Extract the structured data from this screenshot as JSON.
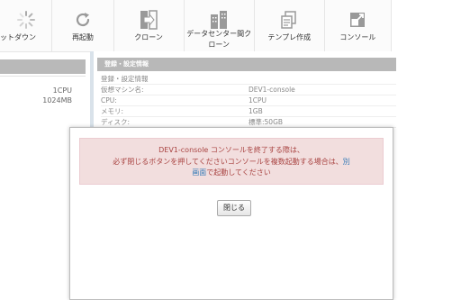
{
  "toolbar": {
    "items": [
      {
        "label": "ットダウン",
        "icon": "shutdown-spinner-icon"
      },
      {
        "label": "再起動",
        "icon": "restart-icon"
      },
      {
        "label": "クローン",
        "icon": "clone-icon"
      },
      {
        "label_line1": "データセンター間ク",
        "label_line2": "ローン",
        "icon": "datacenter-clone-icon"
      },
      {
        "label": "テンプレ作成",
        "icon": "template-icon"
      },
      {
        "label": "コンソール",
        "icon": "console-icon"
      }
    ]
  },
  "left_panel": {
    "cpu": "1CPU",
    "memory": "1024MB"
  },
  "info_panel": {
    "header": "登録・設定情報",
    "subheader": "登録・設定情報",
    "rows": [
      {
        "key": "仮想マシン名:",
        "value": "DEV1-console"
      },
      {
        "key": "CPU:",
        "value": "1CPU"
      },
      {
        "key": "メモリ:",
        "value": "1GB"
      },
      {
        "key": "ディスク:",
        "value": "標準:50GB"
      }
    ]
  },
  "modal": {
    "line1": "DEV1-console コンソールを終了する際は、",
    "line2a": "必ず閉じるボタンを押してくださいコンソールを複数起動する場合は、",
    "link_part1": "別",
    "link_part2": "画面",
    "line3b": "で起動してください",
    "close_label": "閉じる"
  },
  "colors": {
    "alert_bg": "#f2dede",
    "alert_text": "#a94442",
    "link": "#337ab7",
    "panel_header": "#b8b8b8"
  }
}
